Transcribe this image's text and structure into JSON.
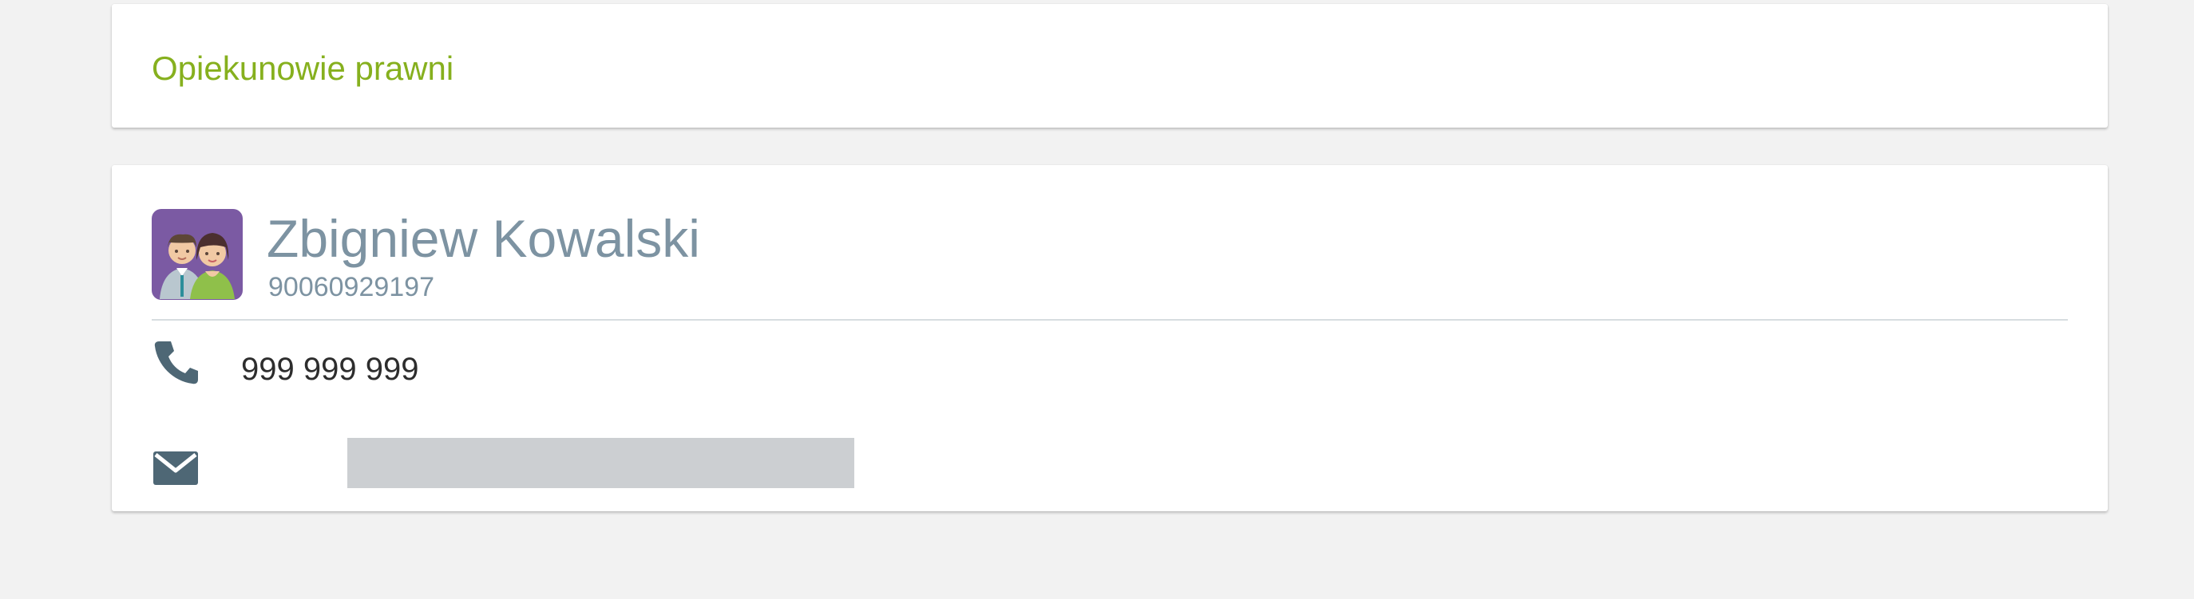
{
  "section": {
    "title": "Opiekunowie prawni"
  },
  "guardian": {
    "name": "Zbigniew Kowalski",
    "id_number": "90060929197",
    "avatar_icon": "guardians-couple-icon",
    "phone": "999 999 999",
    "phone_icon": "phone-icon",
    "email": "",
    "email_icon": "envelope-icon"
  },
  "colors": {
    "accent_green": "#86b01e",
    "name_gray_blue": "#7d93a2",
    "icon_slate": "#4e6775",
    "avatar_purple": "#7b5aa3",
    "page_background": "#f2f2f2",
    "redaction_gray": "#cccfd2"
  }
}
